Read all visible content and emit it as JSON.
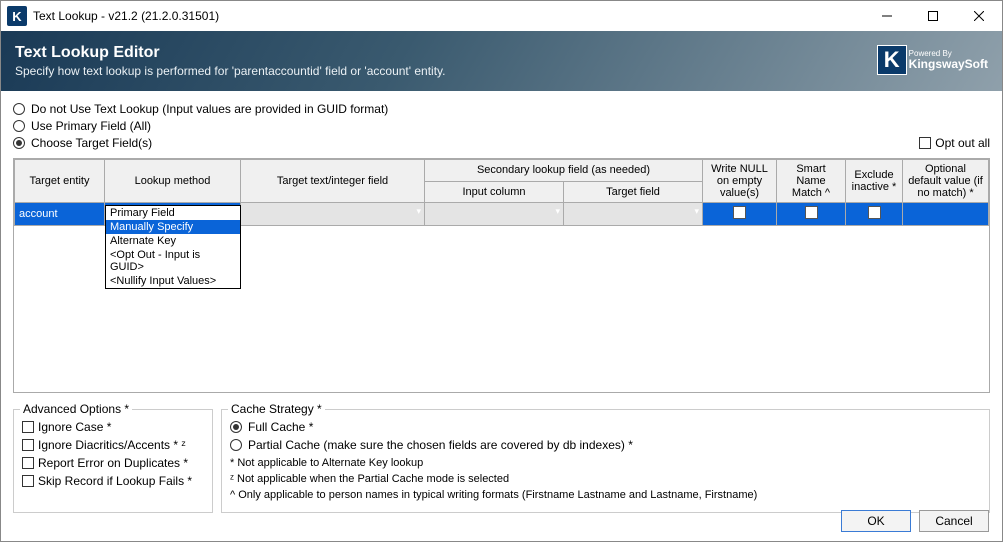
{
  "window": {
    "title": "Text Lookup - v21.2 (21.2.0.31501)"
  },
  "banner": {
    "heading": "Text Lookup Editor",
    "sub": "Specify how text lookup is performed for 'parentaccountid' field or 'account' entity."
  },
  "brand": {
    "powered": "Powered By",
    "name": "KingswaySoft"
  },
  "radios": {
    "opt1": "Do not Use Text Lookup (Input values are provided in GUID format)",
    "opt2": "Use Primary Field (All)",
    "opt3": "Choose Target Field(s)"
  },
  "optout_all": "Opt out all",
  "grid": {
    "headers": {
      "target_entity": "Target entity",
      "lookup_method": "Lookup method",
      "target_text": "Target text/integer field",
      "secondary": "Secondary lookup field (as needed)",
      "input_column": "Input column",
      "target_field": "Target field",
      "write_null": "Write NULL on empty value(s)",
      "smart_name": "Smart Name Match ^",
      "exclude_inactive": "Exclude inactive *",
      "optional_default": "Optional default value (if no match) *"
    },
    "row": {
      "target_entity": "account",
      "lookup_method": "Manually Specify"
    },
    "dropdown": {
      "o1": "Primary Field",
      "o2": "Manually Specify",
      "o3": "Alternate Key",
      "o4": "<Opt Out - Input is GUID>",
      "o5": "<Nullify Input Values>"
    }
  },
  "advanced": {
    "legend": "Advanced Options *",
    "opt1": "Ignore Case *",
    "opt2": "Ignore Diacritics/Accents * ᶻ",
    "opt3": "Report Error on Duplicates *",
    "opt4": "Skip Record if Lookup Fails *"
  },
  "cache": {
    "legend": "Cache Strategy *",
    "opt1": "Full Cache *",
    "opt2": "Partial Cache (make sure the chosen fields are covered by db indexes) *"
  },
  "footnotes": {
    "f1": "* Not applicable to Alternate Key lookup",
    "f2": "ᶻ Not applicable when the Partial Cache mode is selected",
    "f3": "^ Only applicable to person names in typical writing formats (Firstname Lastname and Lastname, Firstname)"
  },
  "buttons": {
    "ok": "OK",
    "cancel": "Cancel"
  }
}
